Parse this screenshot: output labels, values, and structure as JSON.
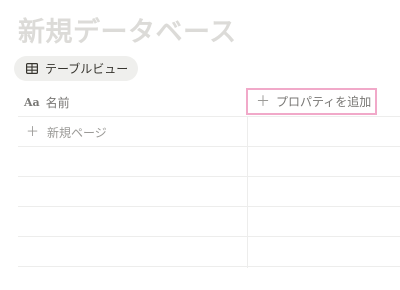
{
  "database": {
    "title": "新規データベース"
  },
  "view_tab": {
    "label": "テーブルビュー",
    "icon": "table-icon"
  },
  "table": {
    "name_column": {
      "icon": "Aa",
      "label": "名前"
    },
    "add_property": {
      "icon": "＋",
      "label": "プロパティを追加"
    },
    "new_page": {
      "icon": "＋",
      "label": "新規ページ"
    }
  },
  "colors": {
    "title": "#dcdbd8",
    "highlight_border": "#f1a9c9",
    "grid_line": "#ededec",
    "muted_text": "#787774"
  }
}
